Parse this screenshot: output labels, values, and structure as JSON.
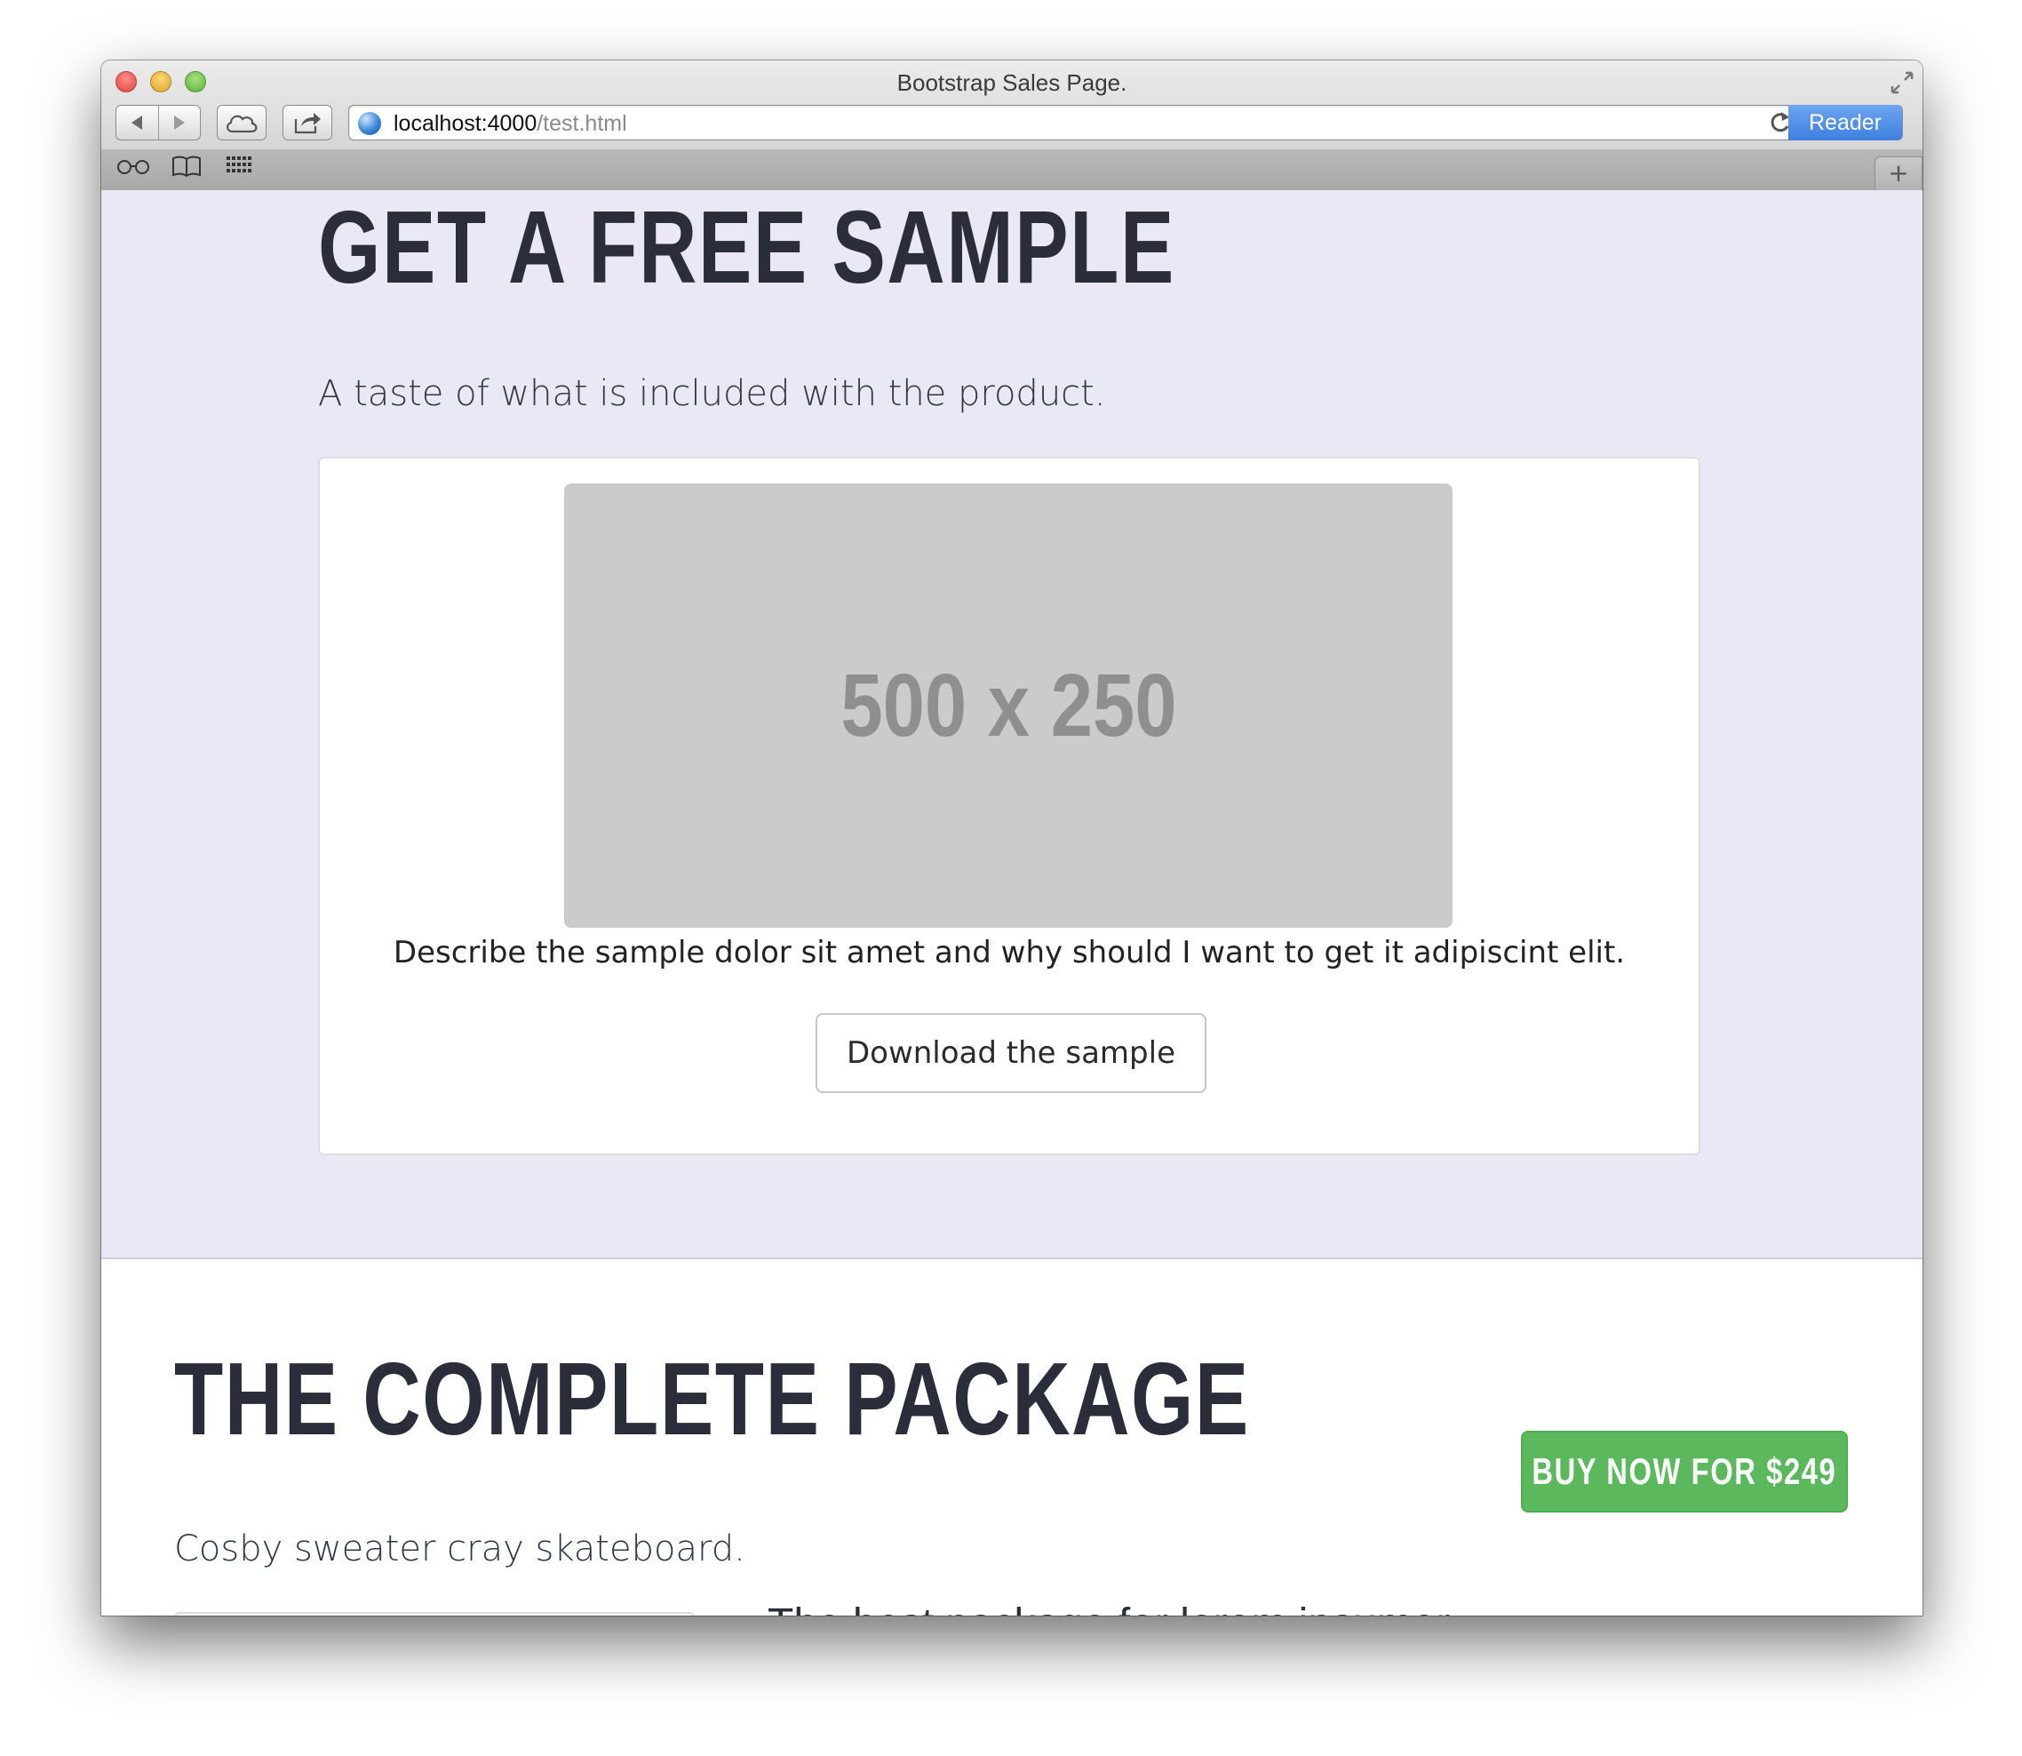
{
  "browser": {
    "window_title": "Bootstrap Sales Page.",
    "url_host": "localhost:4000",
    "url_path": "/test.html",
    "reader_label": "Reader",
    "new_tab_label": "+",
    "icons": {
      "back": "back-arrow-icon",
      "forward": "forward-arrow-icon",
      "cloud": "icloud-tabs-icon",
      "share": "share-icon",
      "reload": "reload-icon",
      "reading_list": "reading-list-glasses-icon",
      "bookmarks": "bookmarks-book-icon",
      "top_sites": "top-sites-grid-icon",
      "fullscreen": "fullscreen-icon"
    }
  },
  "sample_section": {
    "title": "GET A FREE SAMPLE",
    "subtitle": "A taste of what is included with the product.",
    "placeholder_label": "500 x 250",
    "description": "Describe the sample dolor sit amet and why should I want to get it adipiscint elit.",
    "download_label": "Download the sample",
    "background_color": "#e9e8f4"
  },
  "package_section": {
    "title": "THE COMPLETE PACKAGE",
    "subtitle": "Cosby sweater cray skateboard.",
    "buy_label": "BUY NOW FOR $249",
    "heading": "The best package for lorem ipsumer",
    "buy_color": "#5cb85c"
  }
}
